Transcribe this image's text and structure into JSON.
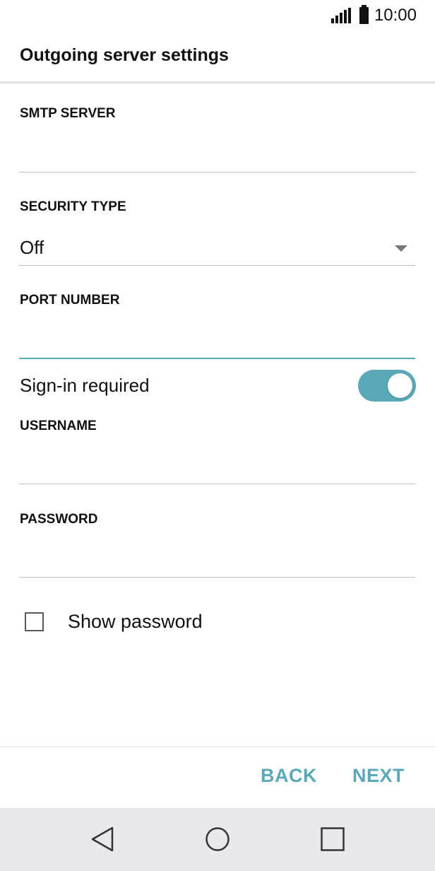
{
  "status_bar": {
    "time": "10:00",
    "signal_icon": "signal-icon",
    "battery_icon": "battery-icon"
  },
  "header": {
    "title": "Outgoing server settings"
  },
  "form": {
    "smtp_server": {
      "label": "SMTP SERVER",
      "value": ""
    },
    "security_type": {
      "label": "SECURITY TYPE",
      "value": "Off"
    },
    "port_number": {
      "label": "PORT NUMBER",
      "value": ""
    },
    "sign_in_required": {
      "label": "Sign-in required",
      "enabled": true
    },
    "username": {
      "label": "USERNAME",
      "value": ""
    },
    "password": {
      "label": "PASSWORD",
      "value": ""
    },
    "show_password": {
      "label": "Show password",
      "checked": false
    }
  },
  "footer": {
    "back_label": "BACK",
    "next_label": "NEXT"
  },
  "nav_bar": {
    "back_icon": "back-triangle-icon",
    "home_icon": "home-circle-icon",
    "recents_icon": "recents-square-icon"
  },
  "colors": {
    "accent": "#5aa9b8",
    "nav_background": "#e7e9ec"
  }
}
